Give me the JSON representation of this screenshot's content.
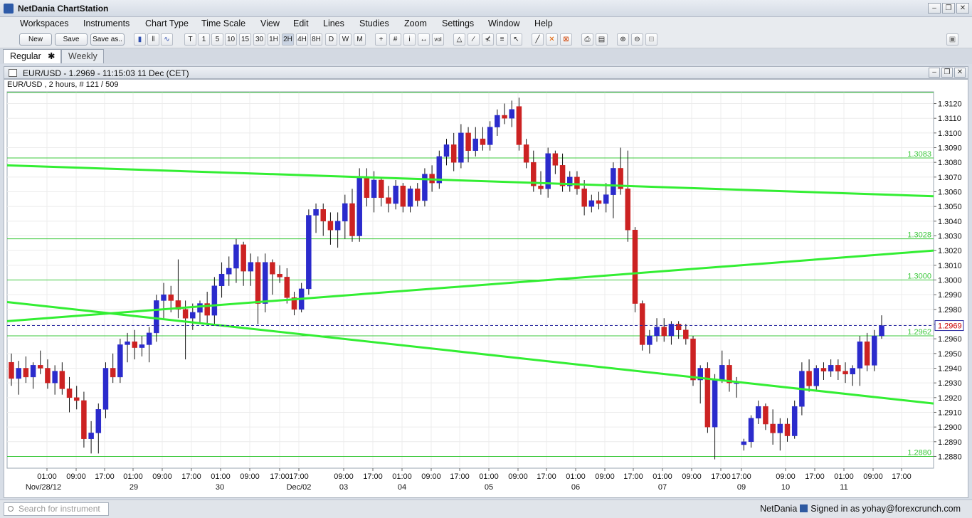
{
  "app": {
    "title": "NetDania ChartStation"
  },
  "window_buttons": [
    "–",
    "❐",
    "✕"
  ],
  "menu": [
    "Workspaces",
    "Instruments",
    "Chart Type",
    "Time Scale",
    "View",
    "Edit",
    "Lines",
    "Studies",
    "Zoom",
    "Settings",
    "Window",
    "Help"
  ],
  "toolbar": {
    "new_label": "New",
    "save_label": "Save",
    "save_as_label": "Save as..",
    "timeframes": [
      "T",
      "1",
      "5",
      "10",
      "15",
      "30",
      "1H",
      "2H",
      "4H",
      "8H",
      "D",
      "W",
      "M"
    ],
    "icons": [
      "candles-icon",
      "bars-icon",
      "line-chart-icon",
      "crosshair-icon",
      "grid-icon",
      "info-icon",
      "scale-icon",
      "volume-icon",
      "bell-icon",
      "trendline-icon",
      "fan-icon",
      "fibonacci-icon",
      "cursor-icon",
      "draw-line-icon",
      "delete-icon",
      "delete-all-icon",
      "print-icon",
      "print-preview-icon",
      "zoom-in-icon",
      "zoom-out-icon",
      "zoom-reset-icon"
    ]
  },
  "tabs": [
    {
      "label": "Regular",
      "close": "✱",
      "active": true
    },
    {
      "label": "Weekly",
      "active": false
    }
  ],
  "chart_window": {
    "title": "EUR/USD - 1.2969 - 11:15:03  11 Dec (CET)",
    "info": "EUR/USD , 2 hours, # 121 / 509"
  },
  "chart_data": {
    "type": "candlestick",
    "symbol": "EUR/USD",
    "interval": "2 hours",
    "ylim": [
      1.2872,
      1.3128
    ],
    "y_ticks": [
      "1.3120",
      "1.3110",
      "1.3100",
      "1.3090",
      "1.3080",
      "1.3070",
      "1.3060",
      "1.3050",
      "1.3040",
      "1.3030",
      "1.3020",
      "1.3010",
      "1.3000",
      "1.2990",
      "1.2980",
      "1.2970",
      "1.2960",
      "1.2950",
      "1.2940",
      "1.2930",
      "1.2920",
      "1.2910",
      "1.2900",
      "1.2890",
      "1.2880"
    ],
    "x_time_labels": [
      "01:00",
      "09:00",
      "17:00",
      "01:00",
      "09:00",
      "17:00",
      "01:00",
      "09:00",
      "17:00",
      "17:00",
      "09:00",
      "17:00",
      "01:00",
      "09:00",
      "17:00",
      "01:00",
      "09:00",
      "17:00",
      "01:00",
      "09:00",
      "17:00",
      "01:00",
      "09:00",
      "17:00",
      "17:00",
      "09:00",
      "17:00",
      "01:00",
      "09:00",
      "17:00"
    ],
    "x_date_labels": [
      "Nov/28/12",
      "29",
      "30",
      "Dec/02",
      "03",
      "04",
      "05",
      "06",
      "07",
      "09",
      "10",
      "11"
    ],
    "current_price": 1.2969,
    "current_price_label": "1.2969",
    "horizontal_lines": [
      {
        "value": 1.3083,
        "label": "1.3083"
      },
      {
        "value": 1.3028,
        "label": "1.3028"
      },
      {
        "value": 1.3,
        "label": "1.3000"
      },
      {
        "value": 1.2962,
        "label": "1.2962"
      },
      {
        "value": 1.288,
        "label": "1.2880"
      }
    ],
    "trend_lines": [
      {
        "from": [
          0,
          1.3078
        ],
        "to": [
          1,
          1.3057
        ]
      },
      {
        "from": [
          0,
          1.2972
        ],
        "to": [
          1,
          1.302
        ]
      },
      {
        "from": [
          0,
          1.2985
        ],
        "to": [
          1,
          1.2916
        ]
      }
    ],
    "candles": [
      [
        1.2944,
        1.295,
        1.2928,
        1.2933
      ],
      [
        1.2933,
        1.2945,
        1.2922,
        1.294
      ],
      [
        1.294,
        1.2948,
        1.293,
        1.2934
      ],
      [
        1.2934,
        1.2944,
        1.2926,
        1.2942
      ],
      [
        1.2942,
        1.2952,
        1.2936,
        1.294
      ],
      [
        1.294,
        1.2946,
        1.2926,
        1.293
      ],
      [
        1.293,
        1.2942,
        1.2922,
        1.2938
      ],
      [
        1.2938,
        1.2944,
        1.2922,
        1.2926
      ],
      [
        1.2926,
        1.2934,
        1.291,
        1.292
      ],
      [
        1.292,
        1.2928,
        1.2912,
        1.2918
      ],
      [
        1.2918,
        1.2924,
        1.2886,
        1.2892
      ],
      [
        1.2892,
        1.2904,
        1.2882,
        1.2896
      ],
      [
        1.2896,
        1.2916,
        1.2882,
        1.2912
      ],
      [
        1.2912,
        1.2944,
        1.2906,
        1.294
      ],
      [
        1.294,
        1.295,
        1.293,
        1.2934
      ],
      [
        1.2934,
        1.296,
        1.293,
        1.2956
      ],
      [
        1.2956,
        1.2964,
        1.2944,
        1.2958
      ],
      [
        1.2958,
        1.2966,
        1.2946,
        1.2954
      ],
      [
        1.2954,
        1.2962,
        1.2948,
        1.2956
      ],
      [
        1.2956,
        1.2968,
        1.2944,
        1.2964
      ],
      [
        1.2964,
        1.299,
        1.2958,
        1.2986
      ],
      [
        1.2986,
        1.2998,
        1.2974,
        1.299
      ],
      [
        1.299,
        1.2996,
        1.2978,
        1.2986
      ],
      [
        1.2986,
        1.3014,
        1.2974,
        1.298
      ],
      [
        1.298,
        1.2986,
        1.2946,
        1.2974
      ],
      [
        1.2974,
        1.2984,
        1.2966,
        1.2978
      ],
      [
        1.2978,
        1.2986,
        1.297,
        1.2984
      ],
      [
        1.2984,
        1.2992,
        1.297,
        1.2976
      ],
      [
        1.2976,
        1.3002,
        1.297,
        1.2996
      ],
      [
        1.2996,
        1.3012,
        1.2988,
        1.3004
      ],
      [
        1.3004,
        1.3016,
        1.2996,
        1.3008
      ],
      [
        1.3008,
        1.3028,
        1.2998,
        1.3024
      ],
      [
        1.3024,
        1.3026,
        1.2996,
        1.3006
      ],
      [
        1.3006,
        1.3018,
        1.2996,
        1.3012
      ],
      [
        1.3012,
        1.3016,
        1.297,
        1.2984
      ],
      [
        1.2984,
        1.3018,
        1.2978,
        1.3012
      ],
      [
        1.3012,
        1.3014,
        1.299,
        1.3004
      ],
      [
        1.3004,
        1.301,
        1.2998,
        1.3002
      ],
      [
        1.3002,
        1.3008,
        1.2984,
        1.2988
      ],
      [
        1.2988,
        1.2992,
        1.2976,
        1.298
      ],
      [
        1.298,
        1.2998,
        1.2978,
        1.2994
      ],
      [
        1.2994,
        1.3048,
        1.299,
        1.3044
      ],
      [
        1.3044,
        1.3052,
        1.3032,
        1.3048
      ],
      [
        1.3048,
        1.3052,
        1.303,
        1.304
      ],
      [
        1.304,
        1.3046,
        1.3024,
        1.3034
      ],
      [
        1.3034,
        1.3046,
        1.3022,
        1.304
      ],
      [
        1.304,
        1.3058,
        1.3028,
        1.3052
      ],
      [
        1.3052,
        1.3062,
        1.3026,
        1.303
      ],
      [
        1.303,
        1.3076,
        1.3026,
        1.307
      ],
      [
        1.307,
        1.3076,
        1.305,
        1.3056
      ],
      [
        1.3056,
        1.3074,
        1.3046,
        1.3068
      ],
      [
        1.3068,
        1.307,
        1.305,
        1.3056
      ],
      [
        1.3056,
        1.3064,
        1.3046,
        1.3052
      ],
      [
        1.3052,
        1.3068,
        1.3048,
        1.3064
      ],
      [
        1.3064,
        1.3066,
        1.3046,
        1.305
      ],
      [
        1.305,
        1.3064,
        1.3046,
        1.3062
      ],
      [
        1.3062,
        1.3066,
        1.305,
        1.3054
      ],
      [
        1.3054,
        1.3076,
        1.305,
        1.3072
      ],
      [
        1.3072,
        1.3078,
        1.306,
        1.3066
      ],
      [
        1.3066,
        1.3088,
        1.3062,
        1.3084
      ],
      [
        1.3084,
        1.3096,
        1.3078,
        1.3092
      ],
      [
        1.3092,
        1.31,
        1.3074,
        1.308
      ],
      [
        1.308,
        1.3106,
        1.3076,
        1.31
      ],
      [
        1.31,
        1.3104,
        1.308,
        1.3088
      ],
      [
        1.3088,
        1.3104,
        1.3084,
        1.3096
      ],
      [
        1.3096,
        1.3104,
        1.3088,
        1.3092
      ],
      [
        1.3092,
        1.3108,
        1.3088,
        1.3104
      ],
      [
        1.3104,
        1.3116,
        1.3098,
        1.3112
      ],
      [
        1.3112,
        1.312,
        1.3106,
        1.311
      ],
      [
        1.311,
        1.3122,
        1.3104,
        1.3116
      ],
      [
        1.3118,
        1.3124,
        1.3088,
        1.3092
      ],
      [
        1.3092,
        1.3096,
        1.3076,
        1.308
      ],
      [
        1.308,
        1.3088,
        1.306,
        1.3064
      ],
      [
        1.3064,
        1.3074,
        1.3058,
        1.3062
      ],
      [
        1.3062,
        1.309,
        1.3056,
        1.3086
      ],
      [
        1.3086,
        1.3088,
        1.3072,
        1.3078
      ],
      [
        1.3078,
        1.3086,
        1.306,
        1.3064
      ],
      [
        1.3064,
        1.3074,
        1.306,
        1.307
      ],
      [
        1.307,
        1.3074,
        1.3058,
        1.3062
      ],
      [
        1.3062,
        1.3068,
        1.3044,
        1.305
      ],
      [
        1.305,
        1.3058,
        1.3046,
        1.3054
      ],
      [
        1.3054,
        1.306,
        1.3048,
        1.3052
      ],
      [
        1.3052,
        1.3066,
        1.3046,
        1.3058
      ],
      [
        1.3058,
        1.308,
        1.3042,
        1.3076
      ],
      [
        1.3076,
        1.309,
        1.3058,
        1.3062
      ],
      [
        1.3062,
        1.3088,
        1.3026,
        1.3034
      ],
      [
        1.3034,
        1.3036,
        1.2978,
        1.2984
      ],
      [
        1.2984,
        1.2986,
        1.2952,
        1.2956
      ],
      [
        1.2956,
        1.2966,
        1.295,
        1.2962
      ],
      [
        1.2962,
        1.2974,
        1.2958,
        1.2968
      ],
      [
        1.2968,
        1.2974,
        1.2958,
        1.2962
      ],
      [
        1.2962,
        1.2972,
        1.2956,
        1.297
      ],
      [
        1.297,
        1.2972,
        1.296,
        1.2966
      ],
      [
        1.2966,
        1.297,
        1.2956,
        1.296
      ],
      [
        1.296,
        1.2962,
        1.2928,
        1.2932
      ],
      [
        1.2932,
        1.2942,
        1.2916,
        1.294
      ],
      [
        1.294,
        1.2944,
        1.2896,
        1.29
      ],
      [
        1.29,
        1.2936,
        1.2878,
        1.2932
      ],
      [
        1.2932,
        1.2952,
        1.293,
        1.2942
      ],
      [
        1.2942,
        1.2946,
        1.2924,
        1.293
      ],
      [
        1.293,
        1.2934,
        1.292,
        1.293
      ],
      [
        1.2888,
        1.2892,
        1.2884,
        1.289
      ],
      [
        1.289,
        1.2908,
        1.2886,
        1.2906
      ],
      [
        1.2906,
        1.2918,
        1.2902,
        1.2914
      ],
      [
        1.2914,
        1.2916,
        1.2898,
        1.2902
      ],
      [
        1.2902,
        1.2912,
        1.2888,
        1.2896
      ],
      [
        1.2896,
        1.2906,
        1.2884,
        1.2902
      ],
      [
        1.2902,
        1.2906,
        1.289,
        1.2894
      ],
      [
        1.2894,
        1.2918,
        1.2892,
        1.2914
      ],
      [
        1.2914,
        1.2944,
        1.2908,
        1.2938
      ],
      [
        1.2938,
        1.2946,
        1.2924,
        1.2928
      ],
      [
        1.2928,
        1.2942,
        1.2924,
        1.294
      ],
      [
        1.294,
        1.2944,
        1.2932,
        1.2938
      ],
      [
        1.2938,
        1.2946,
        1.2934,
        1.2942
      ],
      [
        1.2942,
        1.2946,
        1.2932,
        1.2938
      ],
      [
        1.2938,
        1.2944,
        1.293,
        1.2936
      ],
      [
        1.2936,
        1.2942,
        1.2928,
        1.294
      ],
      [
        1.294,
        1.2962,
        1.2928,
        1.2958
      ],
      [
        1.2958,
        1.2964,
        1.2938,
        1.2942
      ],
      [
        1.2942,
        1.2966,
        1.2938,
        1.2962
      ],
      [
        1.2962,
        1.2976,
        1.296,
        1.2969
      ]
    ]
  },
  "status": {
    "search_placeholder": "Search for instrument",
    "provider": "NetDania",
    "signed_in": "Signed in as yohay@forexcrunch.com"
  }
}
